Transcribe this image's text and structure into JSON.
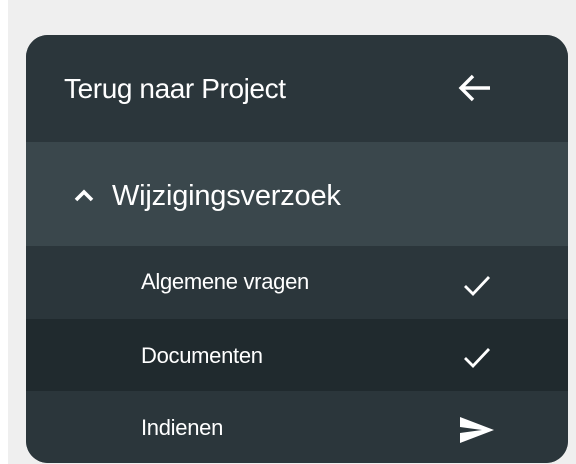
{
  "nav": {
    "back": {
      "label": "Terug naar Project",
      "icon": "arrow-left-icon"
    },
    "section": {
      "label": "Wijzigingsverzoek",
      "icon": "chevron-up-icon",
      "expanded": true
    },
    "items": [
      {
        "label": "Algemene vragen",
        "icon": "checkmark-icon",
        "status": "completed"
      },
      {
        "label": "Documenten",
        "icon": "checkmark-icon",
        "status": "completed"
      },
      {
        "label": "Indienen",
        "icon": "send-icon",
        "status": "pending"
      }
    ]
  },
  "colors": {
    "page_background": "#efefef",
    "panel_background": "#2b363b",
    "section_background": "#3a474c",
    "active_item_background": "#202a2e",
    "text": "#ffffff"
  }
}
